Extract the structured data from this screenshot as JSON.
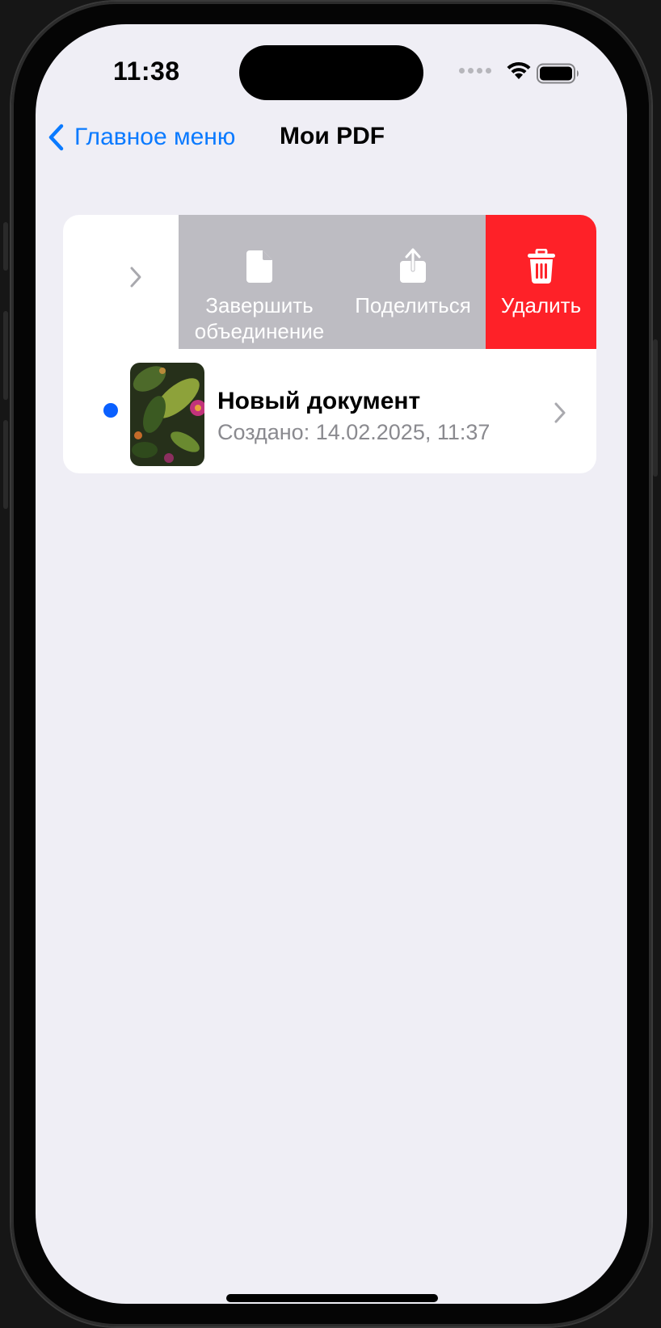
{
  "status_bar": {
    "time": "11:38"
  },
  "nav": {
    "back_label": "Главное меню",
    "title": "Мои PDF"
  },
  "swipe_actions": {
    "merge_label_line1": "Завершить",
    "merge_label_line2": "объединение",
    "share_label": "Поделиться",
    "delete_label": "Удалить"
  },
  "documents": [
    {
      "title": "Новый документ",
      "subtitle": "Создано: 14.02.2025, 11:37",
      "unread": true
    }
  ],
  "colors": {
    "accent": "#0a7aff",
    "action_gray": "#bdbcc2",
    "delete_red": "#fe2128",
    "unread_dot": "#0a60ff",
    "background": "#efeef5"
  },
  "icons": {
    "back": "chevron-left-icon",
    "merge": "document-icon",
    "share": "share-icon",
    "delete": "trash-icon",
    "disclosure": "chevron-right-icon"
  }
}
